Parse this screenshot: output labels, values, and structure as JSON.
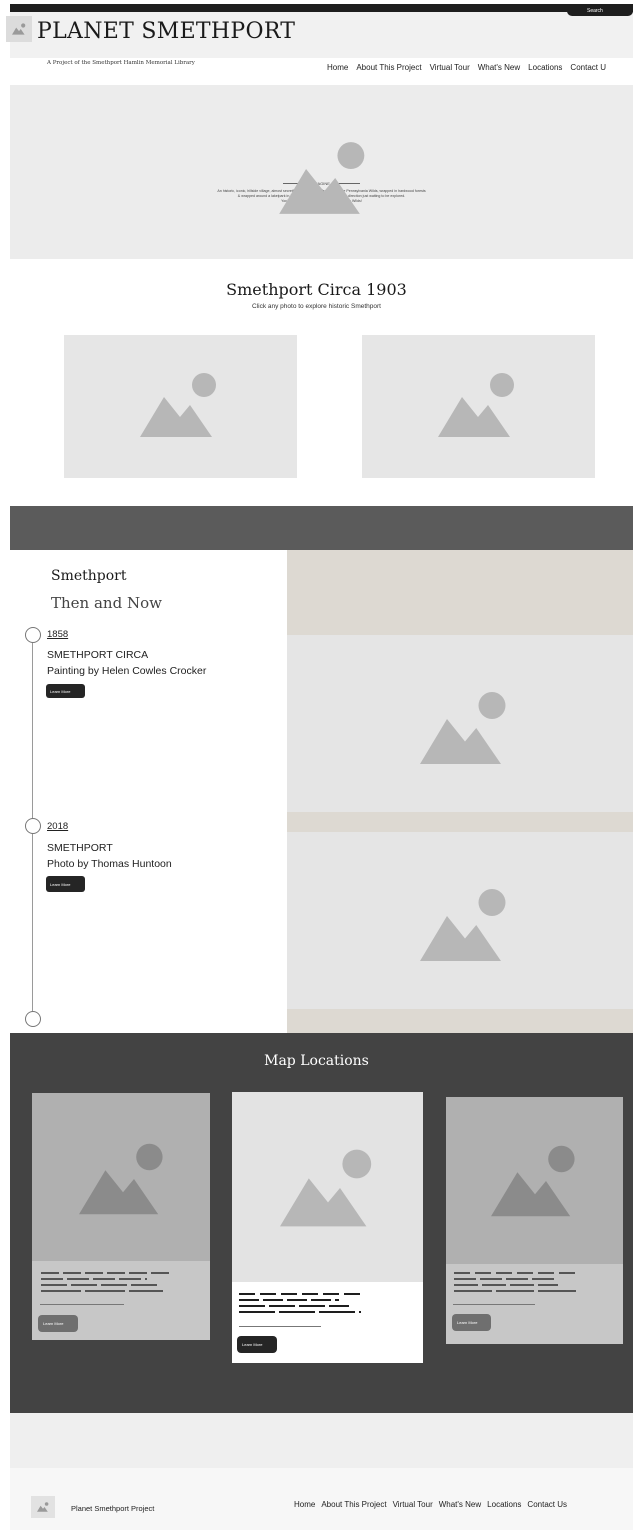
{
  "header": {
    "site_title": "PLANET SMETHPORT",
    "tagline": "A Project of the Smethport Hamlin Memorial Library",
    "search_label": "Search",
    "nav": [
      "Home",
      "About This Project",
      "Virtual Tour",
      "What's New",
      "Locations",
      "Contact U"
    ]
  },
  "hero": {
    "kicker": "IMAGINE",
    "lines": [
      "An historic, iconic, hillside village, almost secretly tucked away in the heart of the Pennsylvania Wilds, wrapped in hardwood forests",
      "& wrapped around a lakelpark in its center. Trails lead out from every direction just waiting to be explored.",
      "You've discovered Smethport, Pennsylvania Wilds!"
    ],
    "image_icon": "image-placeholder-icon"
  },
  "circa": {
    "title": "Smethport Circa 1903",
    "subtitle": "Click any photo to explore historic Smethport"
  },
  "then_now": {
    "title": "Smethport",
    "subtitle": "Then and Now",
    "entries": [
      {
        "year": "1858",
        "heading": "SMETHPORT CIRCA",
        "caption": "Painting by Helen Cowles Crocker",
        "button": "Learn More"
      },
      {
        "year": "2018",
        "heading": "SMETHPORT",
        "caption": "Photo by Thomas Huntoon",
        "button": "Learn More"
      }
    ]
  },
  "map": {
    "title": "Map Locations",
    "cards": [
      {
        "button": "Learn More"
      },
      {
        "button": "Learn More"
      },
      {
        "button": "Learn More"
      }
    ]
  },
  "footer": {
    "name": "Planet Smethport Project",
    "nav": [
      "Home",
      "About This Project",
      "Virtual Tour",
      "What's New",
      "Locations",
      "Contact Us"
    ]
  },
  "colors": {
    "dark": "#1e1e1e",
    "band": "#5b5b5b",
    "map_bg": "#434343",
    "placeholder": "#e6e6e6",
    "placeholder_shape": "#b7b7b7"
  }
}
